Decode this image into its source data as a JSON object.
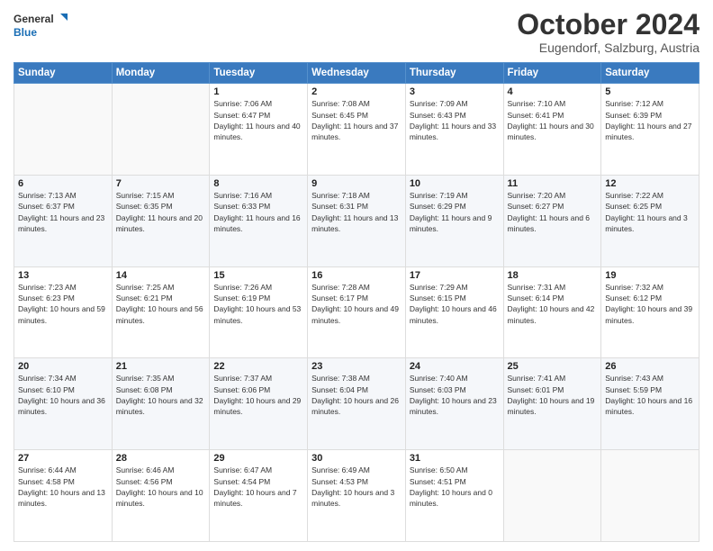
{
  "header": {
    "logo_line1": "General",
    "logo_line2": "Blue",
    "month": "October 2024",
    "location": "Eugendorf, Salzburg, Austria"
  },
  "weekdays": [
    "Sunday",
    "Monday",
    "Tuesday",
    "Wednesday",
    "Thursday",
    "Friday",
    "Saturday"
  ],
  "weeks": [
    [
      {
        "day": "",
        "info": ""
      },
      {
        "day": "",
        "info": ""
      },
      {
        "day": "1",
        "info": "Sunrise: 7:06 AM\nSunset: 6:47 PM\nDaylight: 11 hours and 40 minutes."
      },
      {
        "day": "2",
        "info": "Sunrise: 7:08 AM\nSunset: 6:45 PM\nDaylight: 11 hours and 37 minutes."
      },
      {
        "day": "3",
        "info": "Sunrise: 7:09 AM\nSunset: 6:43 PM\nDaylight: 11 hours and 33 minutes."
      },
      {
        "day": "4",
        "info": "Sunrise: 7:10 AM\nSunset: 6:41 PM\nDaylight: 11 hours and 30 minutes."
      },
      {
        "day": "5",
        "info": "Sunrise: 7:12 AM\nSunset: 6:39 PM\nDaylight: 11 hours and 27 minutes."
      }
    ],
    [
      {
        "day": "6",
        "info": "Sunrise: 7:13 AM\nSunset: 6:37 PM\nDaylight: 11 hours and 23 minutes."
      },
      {
        "day": "7",
        "info": "Sunrise: 7:15 AM\nSunset: 6:35 PM\nDaylight: 11 hours and 20 minutes."
      },
      {
        "day": "8",
        "info": "Sunrise: 7:16 AM\nSunset: 6:33 PM\nDaylight: 11 hours and 16 minutes."
      },
      {
        "day": "9",
        "info": "Sunrise: 7:18 AM\nSunset: 6:31 PM\nDaylight: 11 hours and 13 minutes."
      },
      {
        "day": "10",
        "info": "Sunrise: 7:19 AM\nSunset: 6:29 PM\nDaylight: 11 hours and 9 minutes."
      },
      {
        "day": "11",
        "info": "Sunrise: 7:20 AM\nSunset: 6:27 PM\nDaylight: 11 hours and 6 minutes."
      },
      {
        "day": "12",
        "info": "Sunrise: 7:22 AM\nSunset: 6:25 PM\nDaylight: 11 hours and 3 minutes."
      }
    ],
    [
      {
        "day": "13",
        "info": "Sunrise: 7:23 AM\nSunset: 6:23 PM\nDaylight: 10 hours and 59 minutes."
      },
      {
        "day": "14",
        "info": "Sunrise: 7:25 AM\nSunset: 6:21 PM\nDaylight: 10 hours and 56 minutes."
      },
      {
        "day": "15",
        "info": "Sunrise: 7:26 AM\nSunset: 6:19 PM\nDaylight: 10 hours and 53 minutes."
      },
      {
        "day": "16",
        "info": "Sunrise: 7:28 AM\nSunset: 6:17 PM\nDaylight: 10 hours and 49 minutes."
      },
      {
        "day": "17",
        "info": "Sunrise: 7:29 AM\nSunset: 6:15 PM\nDaylight: 10 hours and 46 minutes."
      },
      {
        "day": "18",
        "info": "Sunrise: 7:31 AM\nSunset: 6:14 PM\nDaylight: 10 hours and 42 minutes."
      },
      {
        "day": "19",
        "info": "Sunrise: 7:32 AM\nSunset: 6:12 PM\nDaylight: 10 hours and 39 minutes."
      }
    ],
    [
      {
        "day": "20",
        "info": "Sunrise: 7:34 AM\nSunset: 6:10 PM\nDaylight: 10 hours and 36 minutes."
      },
      {
        "day": "21",
        "info": "Sunrise: 7:35 AM\nSunset: 6:08 PM\nDaylight: 10 hours and 32 minutes."
      },
      {
        "day": "22",
        "info": "Sunrise: 7:37 AM\nSunset: 6:06 PM\nDaylight: 10 hours and 29 minutes."
      },
      {
        "day": "23",
        "info": "Sunrise: 7:38 AM\nSunset: 6:04 PM\nDaylight: 10 hours and 26 minutes."
      },
      {
        "day": "24",
        "info": "Sunrise: 7:40 AM\nSunset: 6:03 PM\nDaylight: 10 hours and 23 minutes."
      },
      {
        "day": "25",
        "info": "Sunrise: 7:41 AM\nSunset: 6:01 PM\nDaylight: 10 hours and 19 minutes."
      },
      {
        "day": "26",
        "info": "Sunrise: 7:43 AM\nSunset: 5:59 PM\nDaylight: 10 hours and 16 minutes."
      }
    ],
    [
      {
        "day": "27",
        "info": "Sunrise: 6:44 AM\nSunset: 4:58 PM\nDaylight: 10 hours and 13 minutes."
      },
      {
        "day": "28",
        "info": "Sunrise: 6:46 AM\nSunset: 4:56 PM\nDaylight: 10 hours and 10 minutes."
      },
      {
        "day": "29",
        "info": "Sunrise: 6:47 AM\nSunset: 4:54 PM\nDaylight: 10 hours and 7 minutes."
      },
      {
        "day": "30",
        "info": "Sunrise: 6:49 AM\nSunset: 4:53 PM\nDaylight: 10 hours and 3 minutes."
      },
      {
        "day": "31",
        "info": "Sunrise: 6:50 AM\nSunset: 4:51 PM\nDaylight: 10 hours and 0 minutes."
      },
      {
        "day": "",
        "info": ""
      },
      {
        "day": "",
        "info": ""
      }
    ]
  ]
}
